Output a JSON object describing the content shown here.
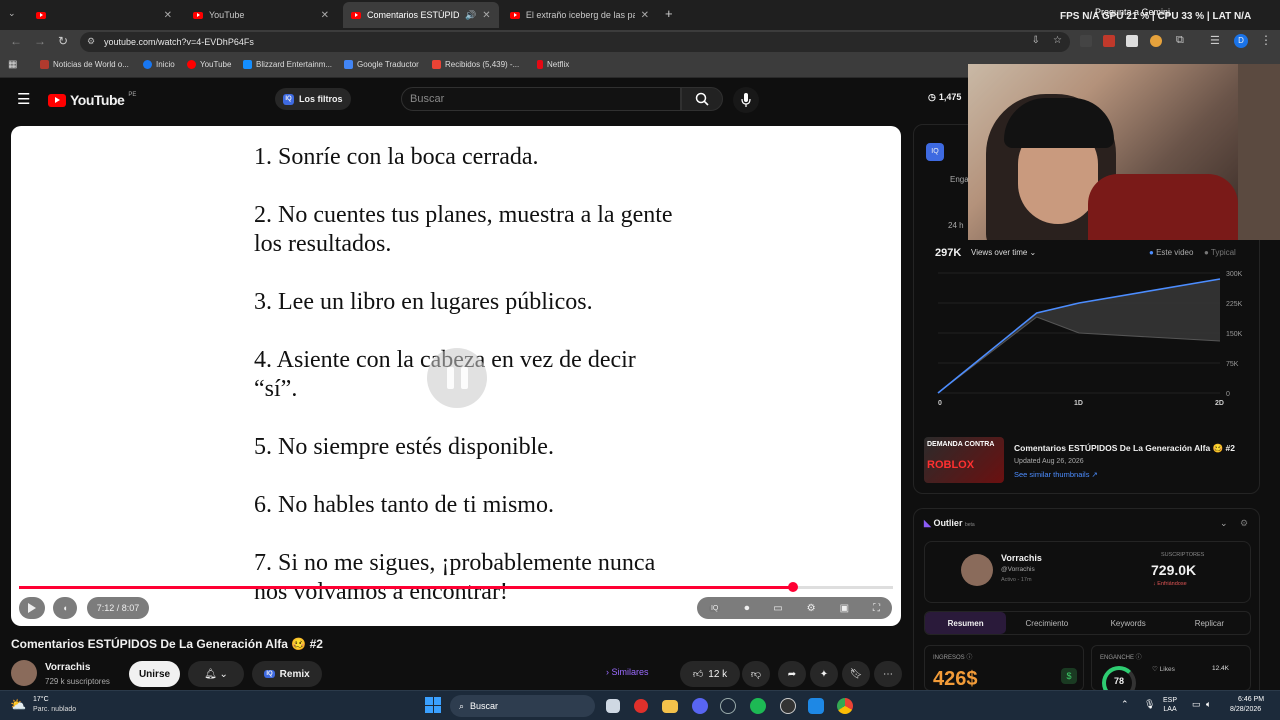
{
  "browser": {
    "tabs": [
      {
        "title": "",
        "active": false
      },
      {
        "title": "YouTube",
        "active": false
      },
      {
        "title": "Comentarios ESTÚPIDOS D",
        "active": true
      },
      {
        "title": "El extraño iceberg de las parad",
        "active": false
      }
    ],
    "new_tab": "+",
    "url": "youtube.com/watch?v=4-EVDhP64Fs",
    "overlay_stats": "FPS N/A GPU 21 % | CPU 33 % | LAT N/A",
    "overlay_gemini": "Pregunta a Gemini",
    "bookmarks": [
      "Noticias de World o...",
      "Inicio",
      "YouTube",
      "Blizzard Entertainm...",
      "Google Traductor",
      "Recibidos (5,439) -...",
      "Netflix"
    ]
  },
  "yt": {
    "logo": "YouTube",
    "logo_region": "PE",
    "filters_label": "Los filtros",
    "search_placeholder": "Buscar",
    "view_counter": "1,475"
  },
  "video": {
    "slide_lines": [
      "1. Sonríe con la boca cerrada.",
      "2. No cuentes tus planes, muestra a la gente los resultados.",
      "3. Lee un libro en lugares públicos.",
      "4. Asiente con la cabeza en vez de decir “sí”.",
      "5. No siempre estés disponible.",
      "6. No hables tanto de ti mismo.",
      "7. Si no me sigues, ¡probablemente nunca nos volvamos a encontrar!"
    ],
    "time": "7:12 / 8:07",
    "progress": 0.886,
    "title": "Comentarios ESTÚPIDOS De La Generación Alfa 🥴 #2",
    "channel": "Vorrachis",
    "subscribers": "729 k suscriptores",
    "join_label": "Unirse",
    "remix_label": "Remix",
    "similar_label": "Similares",
    "likes": "12 k"
  },
  "stats_panel": {
    "views": "297K",
    "views_dropdown": "Views over time",
    "legend_this": "Este video",
    "legend_typical": "Typical",
    "side_labels": [
      "Enga",
      "24 h"
    ]
  },
  "chart_data": {
    "type": "area",
    "x": [
      "0",
      "1D",
      "2D"
    ],
    "y_ticks": [
      "300K",
      "225K",
      "150K",
      "75K",
      "0"
    ],
    "ylim": [
      0,
      300000
    ],
    "series": [
      {
        "name": "Este video",
        "values": [
          [
            0,
            0
          ],
          [
            0.7,
            200000
          ],
          [
            1.0,
            225000
          ],
          [
            2.0,
            285000
          ]
        ]
      },
      {
        "name": "Typical",
        "values": [
          [
            0,
            0
          ],
          [
            0.7,
            190000
          ],
          [
            1.0,
            150000
          ],
          [
            2.0,
            130000
          ]
        ]
      }
    ]
  },
  "similar_thumb": {
    "thumb_text_top": "DEMANDA CONTRA",
    "thumb_text_bottom": "ROBLOX",
    "title": "Comentarios ESTÚPIDOS De La Generación Alfa 🥴 #2",
    "updated": "Updated Aug 26, 2026",
    "link": "See similar thumbnails ↗"
  },
  "outlier": {
    "brand": "Outlier",
    "brand_tag": "beta",
    "channel": "Vorrachis",
    "handle": "@Vorrachis",
    "active": "Activo - 17m",
    "subs_label": "SUSCRIPTORES",
    "subs_value": "729.0K",
    "subs_trend": "↓ Enfriándose",
    "tabs": [
      "Resumen",
      "Crecimiento",
      "Keywords",
      "Replicar"
    ],
    "ingresos_label": "INGRESOS ⓘ",
    "ingresos_value": "426$",
    "enganche_label": "ENGANCHE ⓘ",
    "enganche_value": "78",
    "likes_label": "Likes",
    "likes_value": "12.4K"
  },
  "taskbar": {
    "weather_temp": "17°C",
    "weather_desc": "Parc. nublado",
    "search": "Buscar",
    "lang_1": "ESP",
    "lang_2": "LAA",
    "time": "6:46 PM",
    "date": "8/28/2026"
  }
}
